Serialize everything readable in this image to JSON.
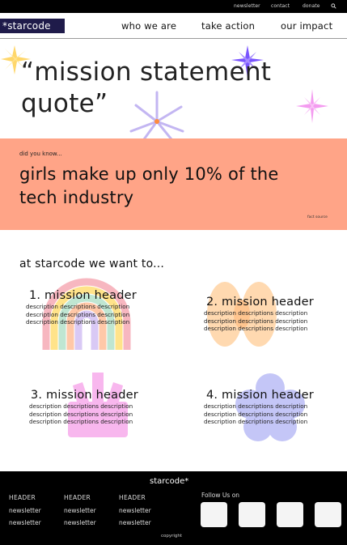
{
  "topbar": {
    "links": [
      "newsletter",
      "contact",
      "donate"
    ],
    "search_icon": "search-icon"
  },
  "nav": {
    "logo": "*starcode",
    "items": [
      "who we are",
      "take action",
      "our impact"
    ]
  },
  "hero": {
    "quote": "“mission statement quote”",
    "decorations": [
      "sparkle-yellow",
      "sparkle-purple",
      "sparkle-lavender",
      "sparkle-pink"
    ]
  },
  "fact": {
    "kicker": "did you know...",
    "statement": "girls make up only 10% of the tech industry",
    "source": "fact source"
  },
  "missions": {
    "title": "at starcode we want to...",
    "items": [
      {
        "header": "1. mission header",
        "desc": "description descriptions description description descriptions description description descriptions description"
      },
      {
        "header": "2. mission header",
        "desc": "description descriptions description description descriptions description description descriptions description"
      },
      {
        "header": "3. mission header",
        "desc": "description descriptions description description descriptions description description descriptions description"
      },
      {
        "header": "4. mission header",
        "desc": "description descriptions description description descriptions description description descriptions description"
      }
    ]
  },
  "footer": {
    "brand": "starcode*",
    "columns": [
      {
        "heading": "HEADER",
        "links": [
          "newsletter",
          "newsletter"
        ]
      },
      {
        "heading": "HEADER",
        "links": [
          "newsletter",
          "newsletter"
        ]
      },
      {
        "heading": "HEADER",
        "links": [
          "newsletter",
          "newsletter"
        ]
      }
    ],
    "follow": "Follow Us on",
    "copyright": "copyright"
  },
  "colors": {
    "topbar": "#000000",
    "logo_bg": "#1f1b4a",
    "fact_band": "#ffa487",
    "footer": "#000000"
  }
}
